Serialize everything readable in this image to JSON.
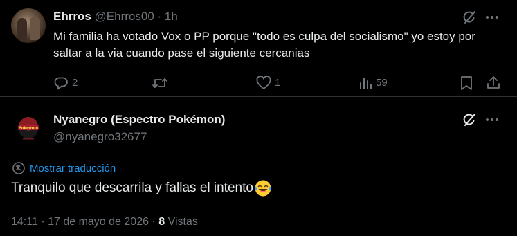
{
  "reply_to": {
    "author_name": "Ehrros",
    "author_handle": "@Ehrros00",
    "separator": "·",
    "time_ago": "1h",
    "text": "Mi familia ha votado Vox o PP porque \"todo es culpa del socialismo\" yo estoy por saltar a la via cuando pase el siguiente cercanias",
    "replies": "2",
    "likes": "1",
    "views": "59",
    "icons": [
      "grok-icon",
      "more-icon",
      "reply-icon",
      "retweet-icon",
      "like-icon",
      "views-icon",
      "bookmark-icon",
      "share-icon"
    ]
  },
  "tweet": {
    "author_name": "Nyanegro (Espectro Pokémon)",
    "author_handle": "@nyanegro32677",
    "avatar_text": "Pokémon",
    "translate_label": "Mostrar traducción",
    "text": "Tranquilo que descarrila y fallas el intento",
    "emoji": "face-with-tears-of-joy",
    "time": "14:11",
    "separator": "·",
    "date": "17 de mayo de 2026",
    "views_count": "8",
    "views_label": "Vistas"
  },
  "colors": {
    "background": "#000000",
    "text": "#e7e9ea",
    "muted": "#71767b",
    "link": "#1d9bf0",
    "divider": "#2f3336"
  }
}
